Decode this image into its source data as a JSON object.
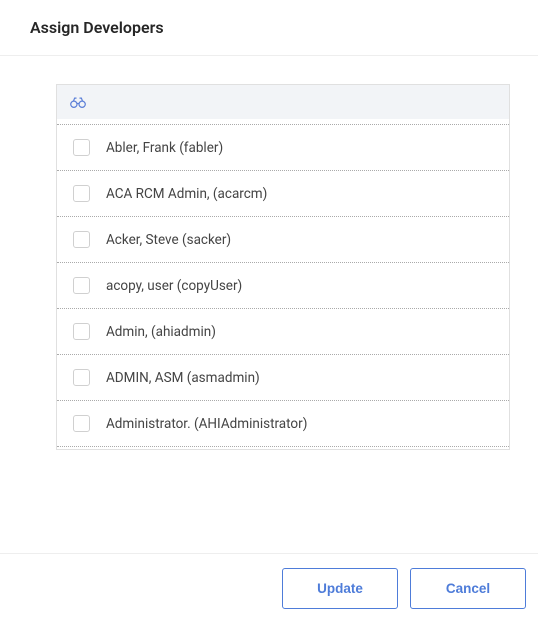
{
  "header": {
    "title": "Assign Developers"
  },
  "list": {
    "items": [
      {
        "label": "Abler, Frank (fabler)",
        "checked": false
      },
      {
        "label": "ACA RCM Admin, (acarcm)",
        "checked": false
      },
      {
        "label": "Acker, Steve (sacker)",
        "checked": false
      },
      {
        "label": "acopy, user (copyUser)",
        "checked": false
      },
      {
        "label": "Admin, (ahiadmin)",
        "checked": false
      },
      {
        "label": "ADMIN, ASM (asmadmin)",
        "checked": false
      },
      {
        "label": "Administrator. (AHIAdministrator)",
        "checked": false
      }
    ]
  },
  "footer": {
    "update_label": "Update",
    "cancel_label": "Cancel"
  },
  "icons": {
    "search": "binoculars-icon"
  },
  "colors": {
    "accent": "#4e7cd9",
    "border": "#e0e0e0",
    "search_bg": "#f2f4f7"
  }
}
